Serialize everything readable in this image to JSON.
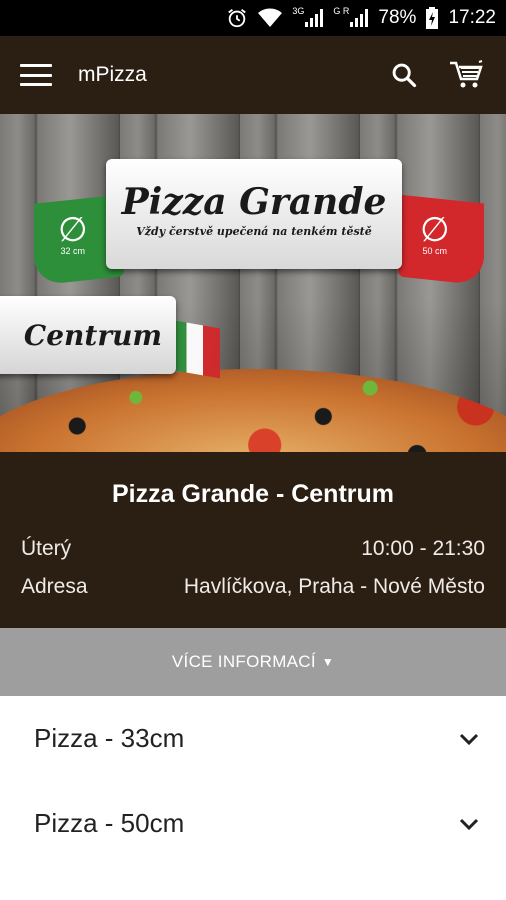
{
  "status": {
    "net1": "3G",
    "net2": "G R",
    "battery": "78%",
    "time": "17:22"
  },
  "appbar": {
    "title": "mPizza"
  },
  "hero": {
    "brand": "Pizza Grande",
    "slogan": "Vždy čerstvě upečená na tenkém těstě",
    "size_left": "32 cm",
    "size_right": "50 cm",
    "branch": "Centrum"
  },
  "info": {
    "name": "Pizza Grande - Centrum",
    "day_label": "Úterý",
    "hours": "10:00 - 21:30",
    "address_label": "Adresa",
    "address": "Havlíčkova, Praha - Nové Město"
  },
  "more_button": {
    "label": "VÍCE INFORMACÍ"
  },
  "categories": [
    {
      "label": "Pizza - 33cm"
    },
    {
      "label": "Pizza - 50cm"
    }
  ]
}
